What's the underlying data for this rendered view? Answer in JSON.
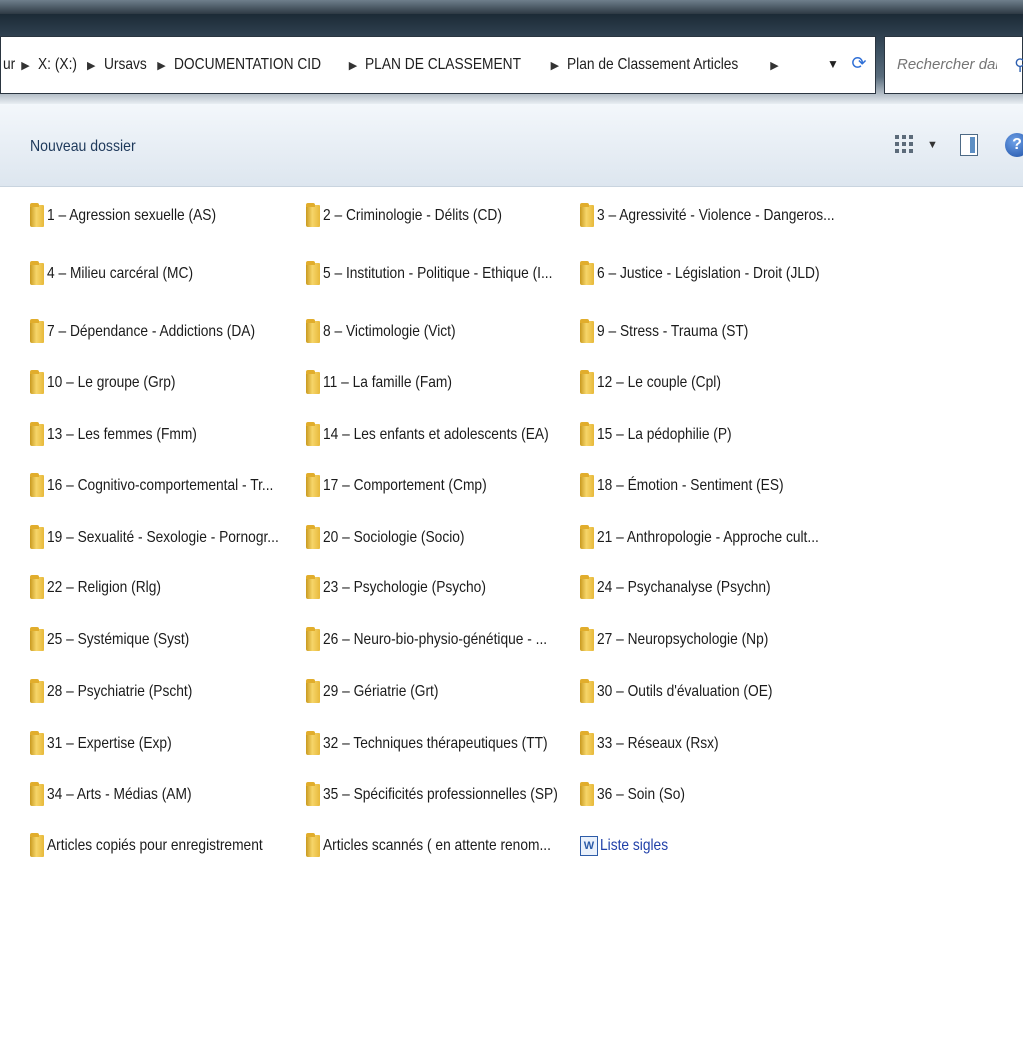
{
  "address": {
    "breadcrumbs": [
      "ur",
      "X: (X:)",
      "Ursavs",
      "DOCUMENTATION CID",
      "PLAN DE CLASSEMENT",
      "Plan de Classement Articles"
    ],
    "search_placeholder": "Rechercher dans ..."
  },
  "toolbar": {
    "new_folder_label": "Nouveau dossier",
    "help_label": "?"
  },
  "items": [
    "1 – Agression sexuelle (AS)",
    "2 – Criminologie - Délits (CD)",
    "3 – Agressivité - Violence - Dangeros...",
    "4 – Milieu carcéral (MC)",
    "5 – Institution - Politique - Ethique (I...",
    "6 – Justice - Législation - Droit (JLD)",
    "7 – Dépendance - Addictions (DA)",
    "8 – Victimologie (Vict)",
    "9 – Stress - Trauma (ST)",
    "10 – Le groupe (Grp)",
    "11 – La famille (Fam)",
    "12 – Le couple (Cpl)",
    "13 – Les femmes (Fmm)",
    "14 – Les enfants et adolescents (EA)",
    "15 – La pédophilie (P)",
    "16 – Cognitivo-comportemental - Tr...",
    "17 – Comportement (Cmp)",
    "18 – Émotion - Sentiment (ES)",
    "19 – Sexualité - Sexologie - Pornogr...",
    "20 – Sociologie (Socio)",
    "21 – Anthropologie - Approche cult...",
    "22 – Religion (Rlg)",
    "23 – Psychologie (Psycho)",
    "24 – Psychanalyse (Psychn)",
    "25 – Systémique (Syst)",
    "26 – Neuro-bio-physio-génétique - ...",
    "27 – Neuropsychologie (Np)",
    "28 – Psychiatrie (Pscht)",
    "29 – Gériatrie (Grt)",
    "30 – Outils d'évaluation (OE)",
    "31 – Expertise (Exp)",
    "32 – Techniques thérapeutiques (TT)",
    "33 – Réseaux (Rsx)",
    "34 – Arts - Médias (AM)",
    "35 – Spécificités professionnelles (SP)",
    "36 – Soin (So)",
    "Articles copiés pour enregistrement",
    "Articles scannés ( en attente renom...",
    "Liste sigles"
  ],
  "icons": {
    "folder": "folder-icon",
    "document": "word-document-icon"
  }
}
